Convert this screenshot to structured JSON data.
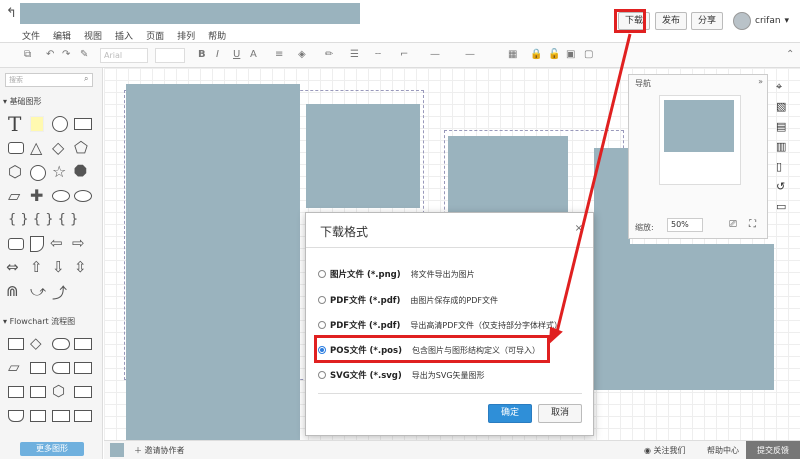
{
  "menu": [
    "文件",
    "编辑",
    "视图",
    "插入",
    "页面",
    "排列",
    "帮助"
  ],
  "header": {
    "download_label": "下载",
    "publish_label": "发布",
    "share_label": "分享",
    "user_name": "crifan",
    "user_caret": "▾"
  },
  "toolbar": {
    "font_placeholder": "Arial"
  },
  "left_panel": {
    "search_placeholder": "搜索",
    "section_basic": "基础图形",
    "section_flowchart": "Flowchart 流程图",
    "more_shapes": "更多图形"
  },
  "nav_panel": {
    "title": "导航",
    "zoom_label": "缩放:",
    "zoom_value": "50%"
  },
  "dialog": {
    "title": "下载格式",
    "close": "×",
    "options": [
      {
        "label": "图片文件 (*.png)",
        "desc": "将文件导出为图片",
        "checked": false
      },
      {
        "label": "PDF文件 (*.pdf)",
        "desc": "由图片保存成的PDF文件",
        "checked": false
      },
      {
        "label": "PDF文件 (*.pdf)",
        "desc": "导出高清PDF文件（仅支持部分字体样式）",
        "checked": false
      },
      {
        "label": "POS文件 (*.pos)",
        "desc": "包含图片与图形结构定义（可导入）",
        "checked": true
      },
      {
        "label": "SVG文件 (*.svg)",
        "desc": "导出为SVG矢量图形",
        "checked": false
      }
    ],
    "ok_label": "确定",
    "cancel_label": "取消"
  },
  "bottom_bar": {
    "invite": "邀请协作者",
    "follow_us": "关注我们",
    "help_center": "帮助中心",
    "feedback": "提交反馈"
  },
  "colors": {
    "highlight": "#e02020",
    "primary_button": "#2f8fd8",
    "redaction": "#9ab3be"
  }
}
